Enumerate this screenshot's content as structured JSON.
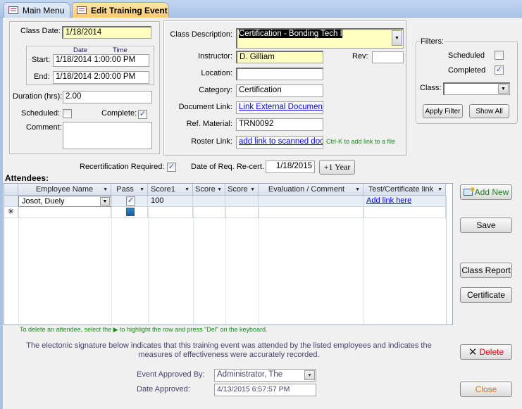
{
  "tabs": [
    {
      "label": "Main Menu",
      "active": false
    },
    {
      "label": "Edit Training Event",
      "active": true
    }
  ],
  "class_info": {
    "class_date_label": "Class Date:",
    "class_date": "1/18/2014",
    "date_header": "Date",
    "time_header": "Time",
    "start_label": "Start:",
    "start": "1/18/2014 1:00:00 PM",
    "end_label": "End:",
    "end": "1/18/2014 2:00:00 PM",
    "duration_label": "Duration (hrs):",
    "duration": "2.00",
    "scheduled_label": "Scheduled:",
    "scheduled": false,
    "complete_label": "Complete:",
    "complete": true,
    "comment_label": "Comment:",
    "comment": ""
  },
  "details": {
    "class_description_label": "Class Description:",
    "class_description": "Certification - Bonding  Tech I",
    "instructor_label": "Instructor:",
    "instructor": "D. Gilliam",
    "rev_label": "Rev:",
    "rev": "",
    "location_label": "Location:",
    "location": "",
    "category_label": "Category:",
    "category": "Certification",
    "document_link_label": "Document Link:",
    "document_link": "Link  External  Document",
    "ref_material_label": "Ref. Material:",
    "ref_material": "TRN0092",
    "roster_link_label": "Roster Link:",
    "roster_link": "add link to scanned doc",
    "roster_hint": "Ctrl-K to add link to a file"
  },
  "filters": {
    "title": "Filters:",
    "scheduled_label": "Scheduled",
    "scheduled": false,
    "completed_label": "Completed",
    "completed": true,
    "class_label": "Class:",
    "class_value": "",
    "apply_label": "Apply Filter",
    "show_all_label": "Show All"
  },
  "recert": {
    "required_label": "Recertification Required:",
    "required": true,
    "date_label": "Date of Req. Re-cert.",
    "date": "1/18/2015",
    "plus_year_label": "+1 Year"
  },
  "attendees": {
    "title": "Attendees:",
    "columns": [
      "Employee Name",
      "Pass",
      "Score1",
      "Score",
      "Score",
      "Evaluation / Comment",
      "Test/Certificate link"
    ],
    "rows": [
      {
        "employee": "Josot, Duely",
        "pass": true,
        "score1": "100",
        "score2": "",
        "score3": "",
        "evaluation": "",
        "link": "Add link here"
      }
    ],
    "new_row_marker": "✳",
    "delete_hint": "To delete an attendee, select the  ▶  to highlight the row and press \"Del\" on the keyboard."
  },
  "signature": {
    "text_line1": "The electonic signature below indicates that this training event was attended by the listed employees and indicates the",
    "text_line2": "measures of effectiveness were accurately recorded.",
    "approved_by_label": "Event Approved By:",
    "approved_by": "Administrator, The",
    "date_approved_label": "Date Approved:",
    "date_approved": "4/13/2015 6:57:57 PM"
  },
  "buttons": {
    "add_new": "Add New",
    "save": "Save",
    "class_report": "Class Report",
    "certificate": "Certificate",
    "delete": "Delete",
    "close": "Close"
  },
  "colors": {
    "hint_green": "#1a8a1a",
    "signature_text": "#4a3f6b",
    "delete_red": "#e00000",
    "close_orange": "#e46c0a",
    "add_new_green": "#1a7a1a"
  }
}
